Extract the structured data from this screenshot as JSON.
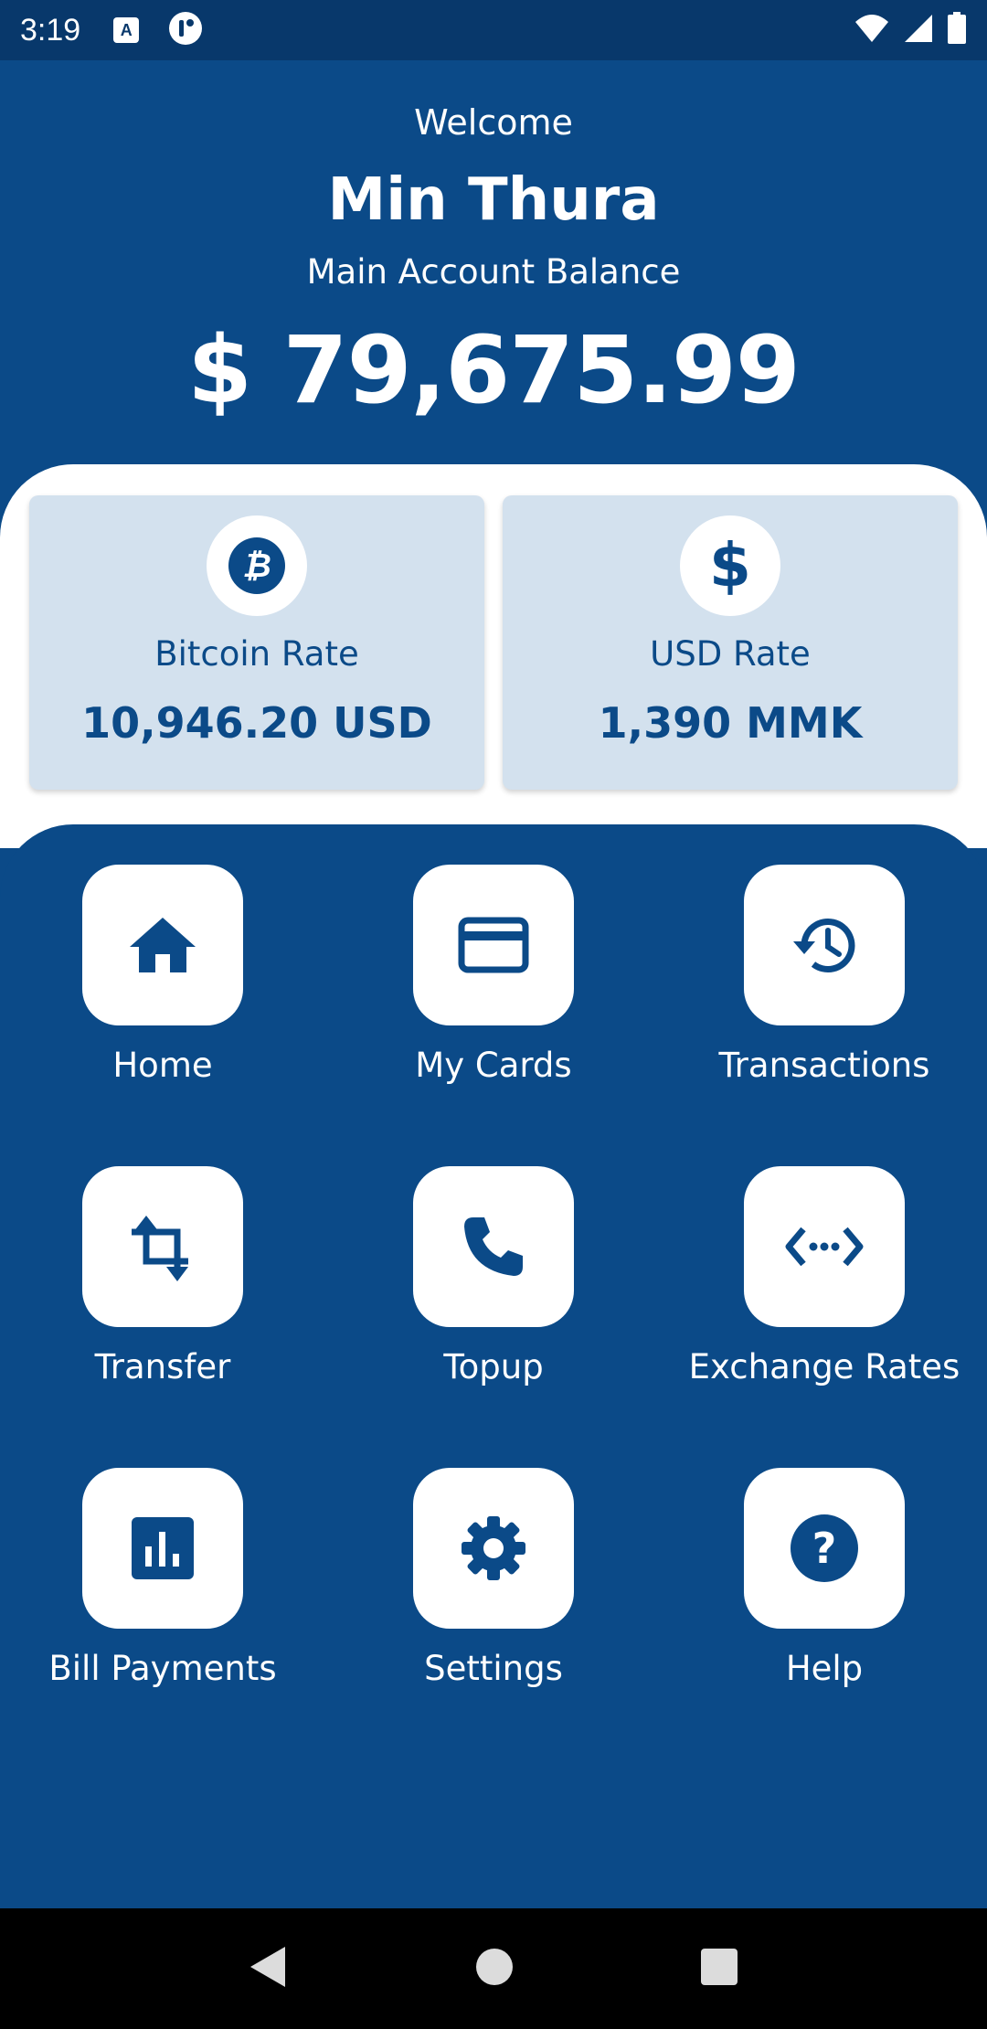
{
  "status_bar": {
    "time": "3:19",
    "notification_icons": [
      "a-icon",
      "circle-app-icon"
    ],
    "system_icons": [
      "wifi-icon",
      "signal-icon",
      "battery-icon"
    ]
  },
  "header": {
    "welcome": "Welcome",
    "user_name": "Min Thura",
    "balance_label": "Main Account Balance",
    "balance": "$ 79,675.99"
  },
  "rates": [
    {
      "icon": "bitcoin-icon",
      "label": "Bitcoin Rate",
      "value": "10,946.20 USD"
    },
    {
      "icon": "dollar-icon",
      "label": "USD Rate",
      "value": "1,390 MMK"
    }
  ],
  "menu": [
    {
      "icon": "home-icon",
      "label": "Home"
    },
    {
      "icon": "credit-card-icon",
      "label": "My Cards"
    },
    {
      "icon": "history-icon",
      "label": "Transactions"
    },
    {
      "icon": "transfer-icon",
      "label": "Transfer"
    },
    {
      "icon": "phone-icon",
      "label": "Topup"
    },
    {
      "icon": "code-arrows-icon",
      "label": "Exchange Rates"
    },
    {
      "icon": "bar-chart-icon",
      "label": "Bill Payments"
    },
    {
      "icon": "gear-icon",
      "label": "Settings"
    },
    {
      "icon": "help-icon",
      "label": "Help"
    }
  ],
  "colors": {
    "primary": "#0b4a88",
    "status_bar": "#08386b",
    "card_bg": "#d3e1ee",
    "white": "#ffffff"
  },
  "nav_bar": {
    "buttons": [
      "back-icon",
      "home-circle-icon",
      "recents-icon"
    ]
  }
}
